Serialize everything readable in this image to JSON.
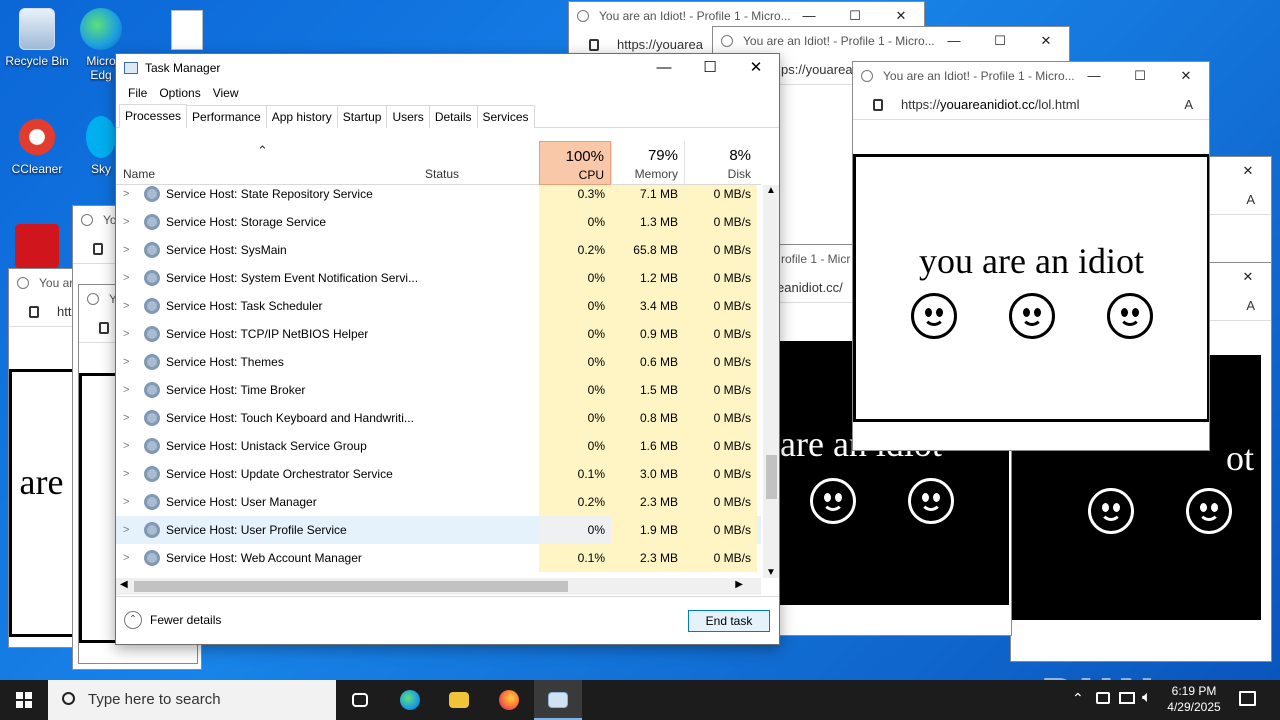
{
  "desktop": {
    "icons": [
      {
        "label": "Recycle Bin",
        "icon": "recycle-bin-icon"
      },
      {
        "label": "Micro Edg",
        "icon": "edge-icon"
      },
      {
        "label": "CCleaner",
        "icon": "ccleaner-icon"
      },
      {
        "label": "Sky",
        "icon": "skype-icon"
      }
    ]
  },
  "popup": {
    "title": "You are an Idiot! - Profile 1 - Micro...",
    "url_prefix": "https://",
    "url_domain": "youareanidiot.cc",
    "url_path": "/lol.html",
    "message": "you are an idiot",
    "fragments": {
      "short_title": "Yo",
      "short_title2": "You are a",
      "url_partial": "https://youarea",
      "url_partial2": "ps://youarea",
      "profile_partial": "rofile 1 - Micr",
      "url_partial3": "eanidiot.cc/",
      "big_partial": "are an idiot"
    }
  },
  "task_manager": {
    "title": "Task Manager",
    "menu": [
      "File",
      "Options",
      "View"
    ],
    "tabs": [
      "Processes",
      "Performance",
      "App history",
      "Startup",
      "Users",
      "Details",
      "Services"
    ],
    "active_tab": "Processes",
    "columns": {
      "name": "Name",
      "status": "Status",
      "cpu": {
        "pct": "100%",
        "label": "CPU"
      },
      "memory": {
        "pct": "79%",
        "label": "Memory"
      },
      "disk": {
        "pct": "8%",
        "label": "Disk"
      }
    },
    "rows": [
      {
        "name": "Service Host: State Repository Service",
        "cpu": "0.3%",
        "memory": "7.1 MB",
        "disk": "0 MB/s"
      },
      {
        "name": "Service Host: Storage Service",
        "cpu": "0%",
        "memory": "1.3 MB",
        "disk": "0 MB/s"
      },
      {
        "name": "Service Host: SysMain",
        "cpu": "0.2%",
        "memory": "65.8 MB",
        "disk": "0 MB/s"
      },
      {
        "name": "Service Host: System Event Notification Servi...",
        "cpu": "0%",
        "memory": "1.2 MB",
        "disk": "0 MB/s"
      },
      {
        "name": "Service Host: Task Scheduler",
        "cpu": "0%",
        "memory": "3.4 MB",
        "disk": "0 MB/s"
      },
      {
        "name": "Service Host: TCP/IP NetBIOS Helper",
        "cpu": "0%",
        "memory": "0.9 MB",
        "disk": "0 MB/s"
      },
      {
        "name": "Service Host: Themes",
        "cpu": "0%",
        "memory": "0.6 MB",
        "disk": "0 MB/s"
      },
      {
        "name": "Service Host: Time Broker",
        "cpu": "0%",
        "memory": "1.5 MB",
        "disk": "0 MB/s"
      },
      {
        "name": "Service Host: Touch Keyboard and Handwriti...",
        "cpu": "0%",
        "memory": "0.8 MB",
        "disk": "0 MB/s"
      },
      {
        "name": "Service Host: Unistack Service Group",
        "cpu": "0%",
        "memory": "1.6 MB",
        "disk": "0 MB/s"
      },
      {
        "name": "Service Host: Update Orchestrator Service",
        "cpu": "0.1%",
        "memory": "3.0 MB",
        "disk": "0 MB/s"
      },
      {
        "name": "Service Host: User Manager",
        "cpu": "0.2%",
        "memory": "2.3 MB",
        "disk": "0 MB/s"
      },
      {
        "name": "Service Host: User Profile Service",
        "cpu": "0%",
        "memory": "1.9 MB",
        "disk": "0 MB/s",
        "selected": true
      },
      {
        "name": "Service Host: Web Account Manager",
        "cpu": "0.1%",
        "memory": "2.3 MB",
        "disk": "0 MB/s"
      }
    ],
    "footer": {
      "fewer_details": "Fewer details",
      "end_task": "End task"
    },
    "colors": {
      "cpu_header": "#f9c8a8",
      "cpu_cell": "#fff4c4",
      "mem_cell": "#fff4c4",
      "selection": "#e5f1fb"
    }
  },
  "taskbar": {
    "search_placeholder": "Type here to search",
    "time": "6:19 PM",
    "date": "4/29/2025",
    "pinned": [
      "task-view-icon",
      "edge-icon",
      "file-explorer-icon",
      "firefox-icon",
      "task-manager-icon"
    ]
  },
  "watermark": "ANY RUN"
}
